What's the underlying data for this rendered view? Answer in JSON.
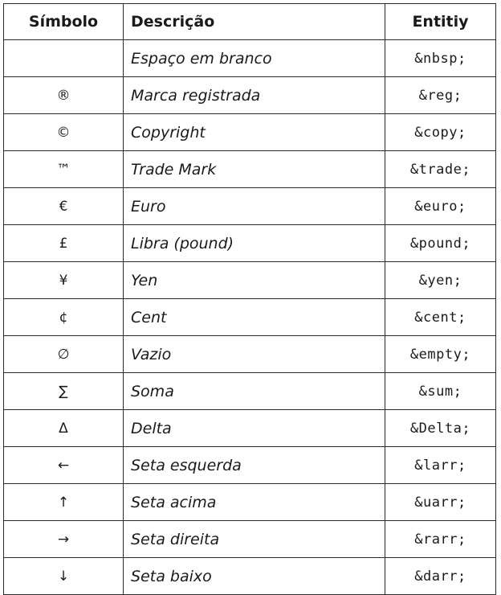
{
  "headers": {
    "symbol": "Símbolo",
    "description": "Descrição",
    "entity": "Entitiy"
  },
  "rows": [
    {
      "symbol": "",
      "description": "Espaço em branco",
      "entity": "&nbsp;"
    },
    {
      "symbol": "®",
      "description": "Marca registrada",
      "entity": "&reg;"
    },
    {
      "symbol": "©",
      "description": "Copyright",
      "entity": "&copy;"
    },
    {
      "symbol": "™",
      "description": "Trade Mark",
      "entity": "&trade;"
    },
    {
      "symbol": "€",
      "description": "Euro",
      "entity": "&euro;"
    },
    {
      "symbol": "£",
      "description": "Libra (pound)",
      "entity": "&pound;"
    },
    {
      "symbol": "¥",
      "description": "Yen",
      "entity": "&yen;"
    },
    {
      "symbol": "¢",
      "description": "Cent",
      "entity": "&cent;"
    },
    {
      "symbol": "∅",
      "description": "Vazio",
      "entity": "&empty;"
    },
    {
      "symbol": "∑",
      "description": "Soma",
      "entity": "&sum;"
    },
    {
      "symbol": "Δ",
      "description": "Delta",
      "entity": "&Delta;"
    },
    {
      "symbol": "←",
      "description": "Seta esquerda",
      "entity": "&larr;"
    },
    {
      "symbol": "↑",
      "description": "Seta acima",
      "entity": "&uarr;"
    },
    {
      "symbol": "→",
      "description": "Seta direita",
      "entity": "&rarr;"
    },
    {
      "symbol": "↓",
      "description": "Seta baixo",
      "entity": "&darr;"
    }
  ]
}
